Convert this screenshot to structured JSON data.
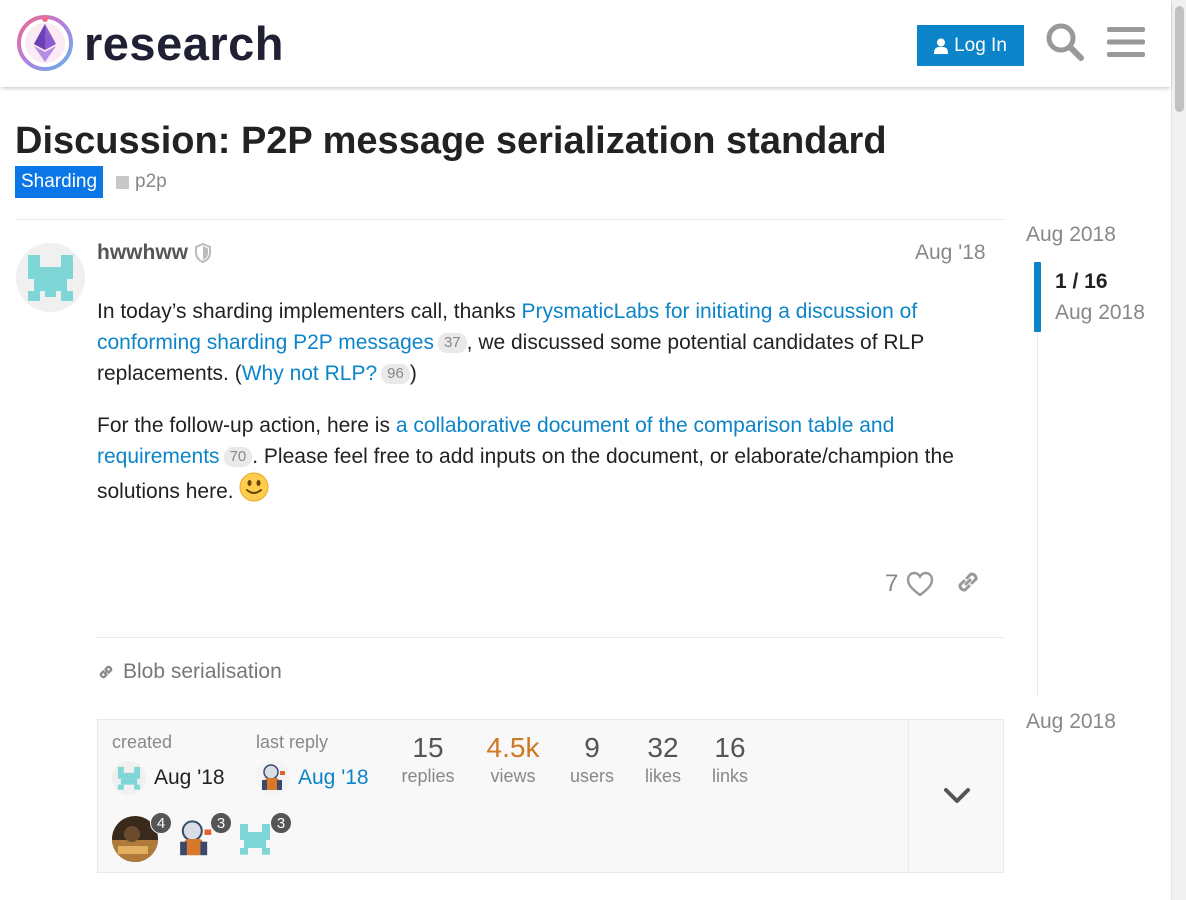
{
  "header": {
    "site_name": "research",
    "login_label": "Log In"
  },
  "topic": {
    "title": "Discussion: P2P message serialization standard",
    "category": "Sharding",
    "tag": "p2p",
    "category_color": "#0b76e8"
  },
  "post": {
    "username": "hwwhww",
    "date": "Aug '18",
    "p1_pre": "In today’s sharding implementers call, thanks ",
    "p1_link": "PrysmaticLabs for initiating a discussion of conforming sharding P2P messages",
    "p1_link_clicks": "37",
    "p1_mid": ", we discussed some potential candidates of RLP replacements. (",
    "p1_link2": "Why not RLP?",
    "p1_link2_clicks": "96",
    "p1_end": ")",
    "p2_pre": "For the follow-up action, here is ",
    "p2_link": "a collaborative document of the comparison table and requirements",
    "p2_link_clicks": "70",
    "p2_end": ". Please feel free to add inputs on the document, or elaborate/champion the solutions here. ",
    "like_count": "7"
  },
  "linked_topic": "Blob serialisation",
  "topic_map": {
    "created_label": "created",
    "created_date": "Aug '18",
    "last_reply_label": "last reply",
    "last_reply_date": "Aug '18",
    "stats": [
      {
        "num": "15",
        "label": "replies"
      },
      {
        "num": "4.5k",
        "label": "views"
      },
      {
        "num": "9",
        "label": "users"
      },
      {
        "num": "32",
        "label": "likes"
      },
      {
        "num": "16",
        "label": "links"
      }
    ],
    "participants": [
      {
        "count": "4"
      },
      {
        "count": "3"
      },
      {
        "count": "3"
      }
    ]
  },
  "timeline": {
    "start": "Aug 2018",
    "position": "1 / 16",
    "position_date": "Aug 2018",
    "end": "Aug 2018"
  },
  "colors": {
    "accent": "#0c84c9",
    "hot_views": "#cf7721"
  }
}
